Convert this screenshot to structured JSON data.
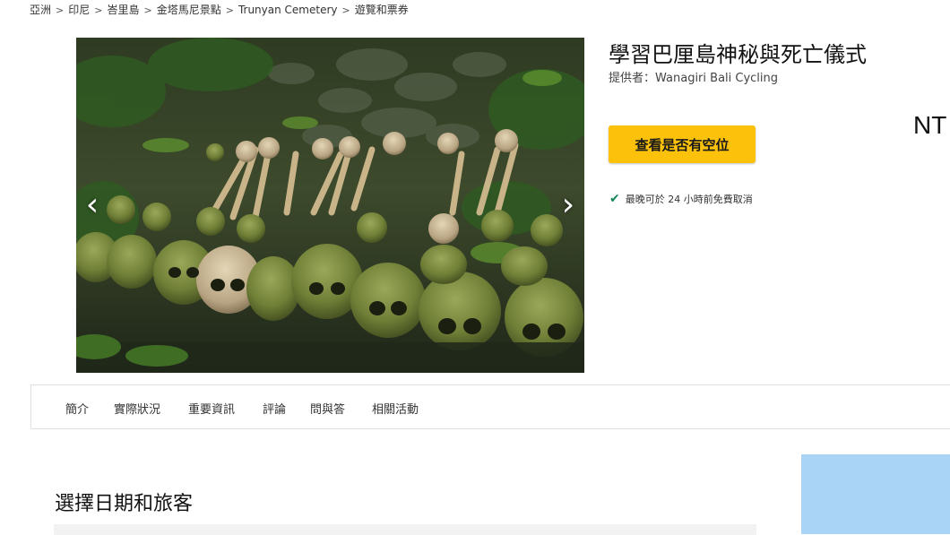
{
  "breadcrumb": {
    "items": [
      "亞洲",
      "印尼",
      "峇里島",
      "金塔馬尼景點",
      "Trunyan Cemetery",
      "遊覽和票券"
    ]
  },
  "product": {
    "title": "學習巴厘島神秘與死亡儀式",
    "provider": "提供者：Wanagiri Bali Cycling",
    "check_availability_label": "查看是否有空位",
    "cancellation_note": "最晚可於 24 小時前免費取消",
    "price_partial": "NT"
  },
  "gallery": {
    "prev_icon": "‹",
    "next_icon": "›"
  },
  "tabs": [
    {
      "label": "簡介"
    },
    {
      "label": "實際狀況"
    },
    {
      "label": "重要資訊"
    },
    {
      "label": "評論"
    },
    {
      "label": "問與答"
    },
    {
      "label": "相關活動"
    }
  ],
  "booking": {
    "section_title": "選擇日期和旅客"
  },
  "colors": {
    "accent_button": "#fcc10a",
    "check_green": "#14885a",
    "side_panel": "#a9d4f5"
  }
}
